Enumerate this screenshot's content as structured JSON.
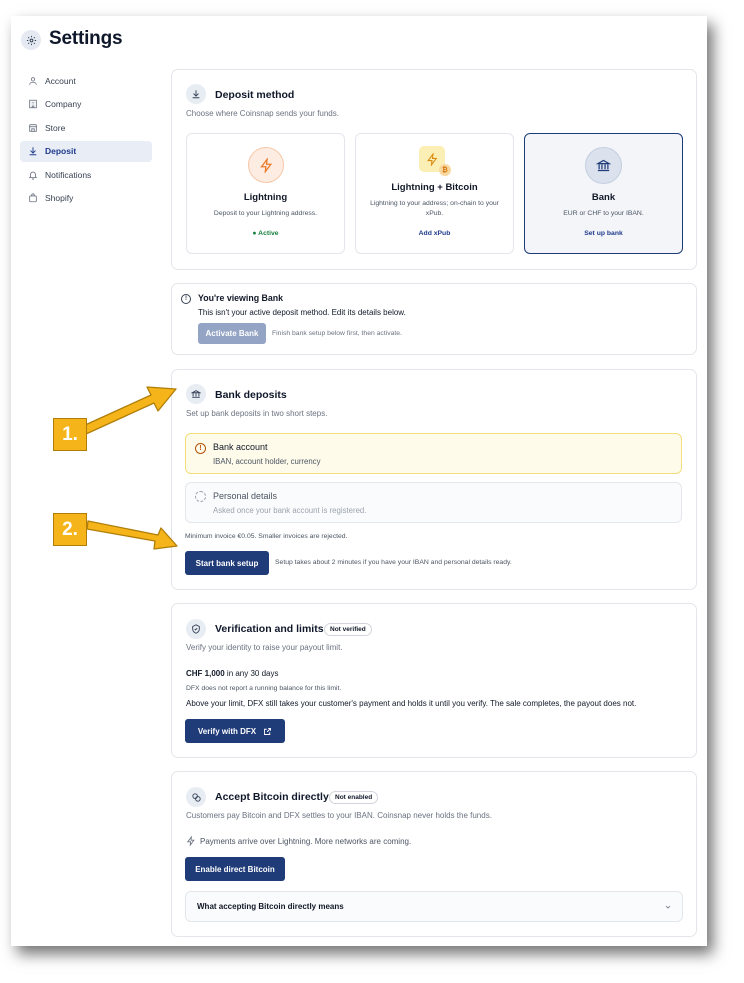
{
  "page": {
    "title": "Settings"
  },
  "sidebar": {
    "items": [
      {
        "label": "Account",
        "icon": "user-icon"
      },
      {
        "label": "Company",
        "icon": "building-icon"
      },
      {
        "label": "Store",
        "icon": "store-icon"
      },
      {
        "label": "Deposit",
        "icon": "download-icon",
        "active": true
      },
      {
        "label": "Notifications",
        "icon": "bell-icon"
      },
      {
        "label": "Shopify",
        "icon": "bag-icon"
      }
    ]
  },
  "deposit_method": {
    "title": "Deposit method",
    "subtitle": "Choose where Coinsnap sends your funds.",
    "options": [
      {
        "title": "Lightning",
        "desc": "Deposit to your Lightning address.",
        "foot": "● Active"
      },
      {
        "title": "Lightning + Bitcoin",
        "desc": "Lightning to your address; on-chain to your xPub.",
        "foot": "Add xPub"
      },
      {
        "title": "Bank",
        "desc": "EUR or CHF to your IBAN.",
        "foot": "Set up bank"
      }
    ]
  },
  "viewing": {
    "title": "You're viewing Bank",
    "desc": "This isn't your active deposit method. Edit its details below.",
    "activate_label": "Activate Bank",
    "activate_hint": "Finish bank setup below first, then activate."
  },
  "bank_deposits": {
    "title": "Bank deposits",
    "subtitle": "Set up bank deposits in two short steps.",
    "steps": [
      {
        "title": "Bank account",
        "desc": "IBAN, account holder, currency"
      },
      {
        "title": "Personal details",
        "desc": "Asked once your bank account is registered."
      }
    ],
    "min_invoice": "Minimum invoice €0.05. Smaller invoices are rejected.",
    "start_label": "Start bank setup",
    "start_hint": "Setup takes about 2 minutes if you have your IBAN and personal details ready."
  },
  "verification": {
    "title": "Verification and limits",
    "badge": "Not verified",
    "subtitle": "Verify your identity to raise your payout limit.",
    "limit_amount": "CHF 1,000",
    "limit_period": " in any 30 days",
    "note": "DFX does not report a running balance for this limit.",
    "explain": "Above your limit, DFX still takes your customer's payment and holds it until you verify. The sale completes, the payout does not.",
    "verify_label": "Verify with DFX"
  },
  "accept_bitcoin": {
    "title": "Accept Bitcoin directly",
    "badge": "Not enabled",
    "subtitle": "Customers pay Bitcoin and DFX settles to your IBAN. Coinsnap never holds the funds.",
    "note": "Payments arrive over Lightning. More networks are coming.",
    "enable_label": "Enable direct Bitcoin",
    "accordion_label": "What accepting Bitcoin directly means"
  },
  "annotations": {
    "first": "1.",
    "second": "2."
  },
  "colors": {
    "accent": "#1f3b78",
    "warning_bg": "#fefbea",
    "warning_border": "#f4dd7c",
    "arrow": "#f5b51a",
    "active_green": "#15803d"
  }
}
